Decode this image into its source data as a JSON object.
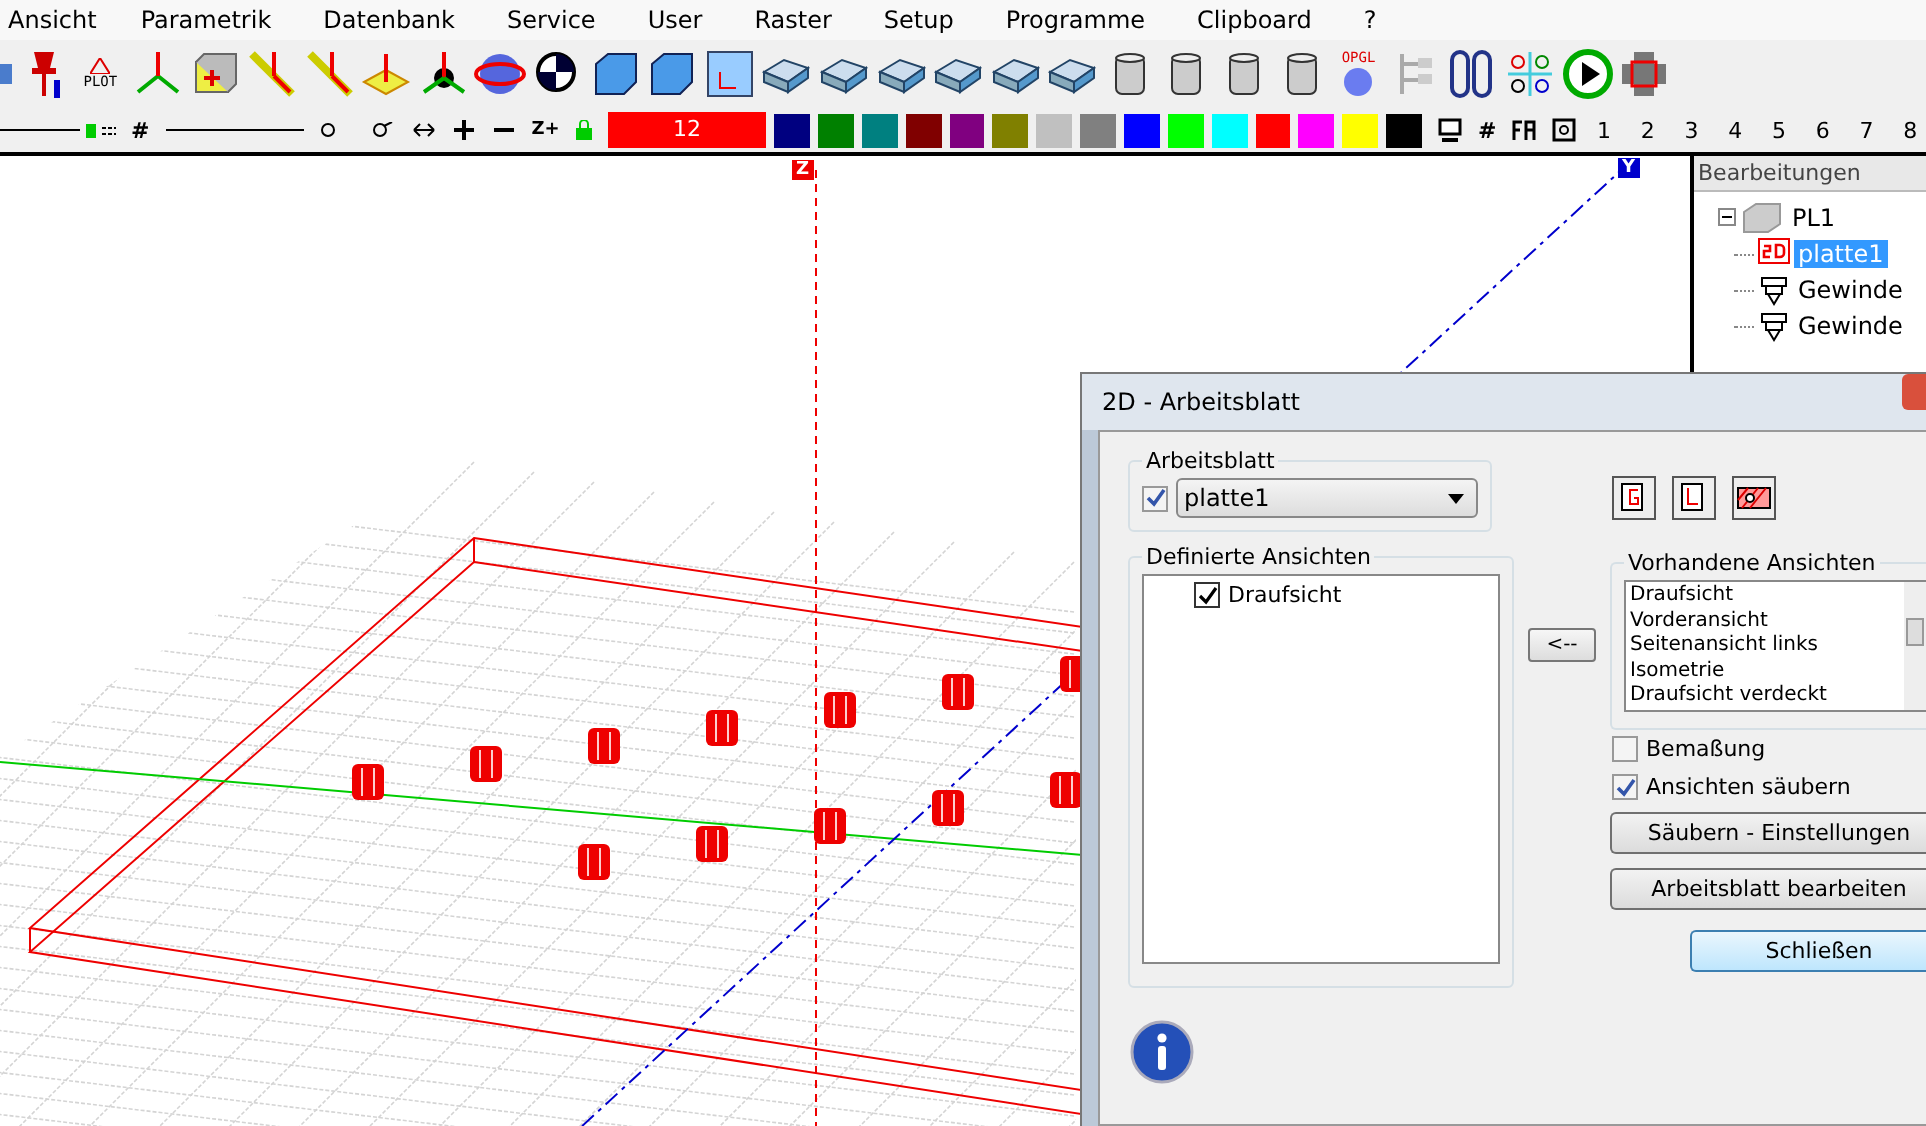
{
  "menu": [
    "Ansicht",
    "Parametrik",
    "Datenbank",
    "Service",
    "User",
    "Raster",
    "Setup",
    "Programme",
    "Clipboard",
    "?"
  ],
  "toolbar": [
    {
      "kind": "pin"
    },
    {
      "kind": "plot",
      "label": "PLOT"
    },
    {
      "kind": "axes"
    },
    {
      "kind": "box-plus"
    },
    {
      "kind": "line"
    },
    {
      "kind": "line"
    },
    {
      "kind": "plane"
    },
    {
      "kind": "tripod"
    },
    {
      "kind": "sphere"
    },
    {
      "kind": "target"
    },
    {
      "kind": "cube"
    },
    {
      "kind": "cube"
    },
    {
      "kind": "frame"
    },
    {
      "kind": "tray"
    },
    {
      "kind": "tray"
    },
    {
      "kind": "tray"
    },
    {
      "kind": "tray"
    },
    {
      "kind": "tray"
    },
    {
      "kind": "tray"
    },
    {
      "kind": "cylinder"
    },
    {
      "kind": "cylinder"
    },
    {
      "kind": "cylinder"
    },
    {
      "kind": "cylinder"
    },
    {
      "kind": "opgl",
      "label": "OPGL"
    },
    {
      "kind": "tree"
    },
    {
      "kind": "clips"
    },
    {
      "kind": "abc"
    },
    {
      "kind": "play"
    },
    {
      "kind": "cross"
    }
  ],
  "toolbar2": {
    "grid_symbol": "#",
    "z_label": "Z+",
    "layer": "12",
    "colors": [
      {
        "color": "#000080"
      },
      {
        "color": "#008000"
      },
      {
        "color": "#008080"
      },
      {
        "color": "#800000"
      },
      {
        "color": "#800080"
      },
      {
        "color": "#808000"
      },
      {
        "color": "#c0c0c0"
      },
      {
        "color": "#808080"
      },
      {
        "color": "#0000ff"
      },
      {
        "color": "#00ff00"
      },
      {
        "color": "#00ffff"
      },
      {
        "color": "#ff0000"
      },
      {
        "color": "#ff00ff"
      },
      {
        "color": "#ffff00"
      },
      {
        "color": "#000000"
      }
    ],
    "grid_symbol2": "#",
    "numbers": [
      "1",
      "2",
      "3",
      "4",
      "5",
      "6",
      "7",
      "8"
    ]
  },
  "viewport": {
    "z_axis_label": "Z",
    "y_axis_label": "Y"
  },
  "tree_panel": {
    "title": "Bearbeitungen",
    "items": [
      {
        "label": "PL1",
        "kind": "part",
        "expanded": true,
        "selected": false,
        "children": [
          {
            "label": "platte1",
            "kind": "sheet",
            "selected": true
          },
          {
            "label": "Gewinde",
            "kind": "thread",
            "selected": false
          },
          {
            "label": "Gewinde",
            "kind": "thread",
            "selected": false
          }
        ]
      }
    ]
  },
  "dialog": {
    "title": "2D - Arbeitsblatt",
    "sheet_group": {
      "title": "Arbeitsblatt",
      "checked": true,
      "value": "platte1"
    },
    "defined_views": {
      "title": "Definierte Ansichten",
      "items": [
        {
          "label": "Draufsicht",
          "checked": true
        }
      ]
    },
    "move_button": "<--",
    "available_views": {
      "title": "Vorhandene Ansichten",
      "items": [
        "Draufsicht",
        "Vorderansicht",
        "Seitenansicht links",
        "Isometrie",
        "Draufsicht verdeckt"
      ]
    },
    "options": [
      {
        "label": "Bemaßung",
        "checked": false
      },
      {
        "label": "Ansichten säubern",
        "checked": true
      }
    ],
    "buttons": [
      {
        "label": "Säubern - Einstellungen",
        "default": false
      },
      {
        "label": "Arbeitsblatt bearbeiten",
        "default": false
      },
      {
        "label": "Schließen",
        "default": true
      }
    ]
  }
}
